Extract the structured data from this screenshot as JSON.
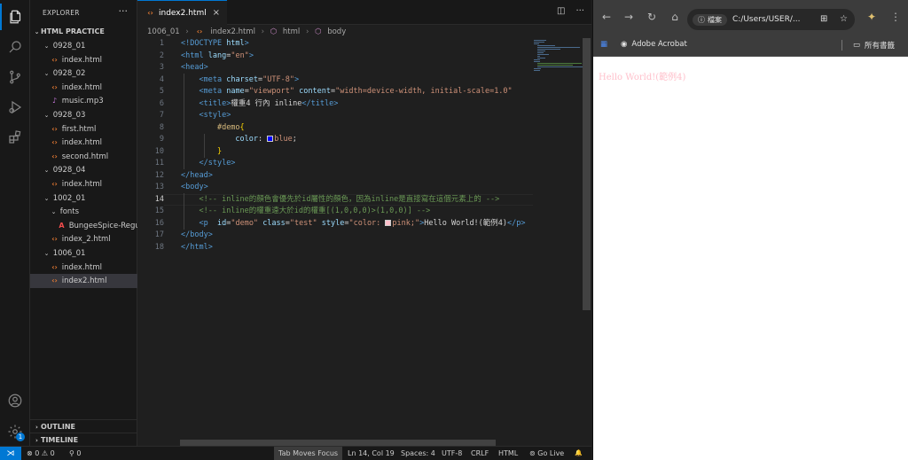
{
  "explorer": {
    "title": "EXPLORER",
    "more": "···",
    "root": "HTML PRACTICE",
    "items": [
      {
        "label": "0928_01",
        "type": "folder"
      },
      {
        "label": "index.html",
        "type": "html"
      },
      {
        "label": "0928_02",
        "type": "folder"
      },
      {
        "label": "index.html",
        "type": "html"
      },
      {
        "label": "music.mp3",
        "type": "music"
      },
      {
        "label": "0928_03",
        "type": "folder"
      },
      {
        "label": "first.html",
        "type": "html"
      },
      {
        "label": "index.html",
        "type": "html"
      },
      {
        "label": "second.html",
        "type": "html"
      },
      {
        "label": "0928_04",
        "type": "folder"
      },
      {
        "label": "index.html",
        "type": "html"
      },
      {
        "label": "1002_01",
        "type": "folder"
      },
      {
        "label": "fonts",
        "type": "folder"
      },
      {
        "label": "BungeeSpice-Regu...",
        "type": "font"
      },
      {
        "label": "index_2.html",
        "type": "html"
      },
      {
        "label": "1006_01",
        "type": "folder"
      },
      {
        "label": "index.html",
        "type": "html"
      },
      {
        "label": "index2.html",
        "type": "html",
        "selected": true
      }
    ],
    "outline": "OUTLINE",
    "timeline": "TIMELINE"
  },
  "tab": {
    "label": "index2.html",
    "close": "×"
  },
  "breadcrumb": {
    "folder": "1006_01",
    "file": "index2.html",
    "html": "html",
    "body": "body"
  },
  "code": {
    "line_numbers": [
      "1",
      "2",
      "3",
      "4",
      "5",
      "6",
      "7",
      "8",
      "9",
      "10",
      "11",
      "12",
      "13",
      "14",
      "15",
      "16",
      "17",
      "18"
    ],
    "current_line": "14",
    "color_swatches": {
      "blue": "#0000ff",
      "pink": "#ffc0cb"
    },
    "lines": [
      [
        {
          "c": "t-tag",
          "t": "<!DOCTYPE "
        },
        {
          "c": "t-attr",
          "t": "html"
        },
        {
          "c": "t-tag",
          "t": ">"
        }
      ],
      [
        {
          "c": "t-tag",
          "t": "<html "
        },
        {
          "c": "t-attr",
          "t": "lang"
        },
        {
          "c": "t-txt",
          "t": "="
        },
        {
          "c": "t-str",
          "t": "\"en\""
        },
        {
          "c": "t-tag",
          "t": ">"
        }
      ],
      [
        {
          "c": "t-tag",
          "t": "<head>"
        }
      ],
      [
        {
          "c": "t-txt",
          "t": "    "
        },
        {
          "c": "t-tag",
          "t": "<meta "
        },
        {
          "c": "t-attr",
          "t": "charset"
        },
        {
          "c": "t-txt",
          "t": "="
        },
        {
          "c": "t-str",
          "t": "\"UTF-8\""
        },
        {
          "c": "t-tag",
          "t": ">"
        }
      ],
      [
        {
          "c": "t-txt",
          "t": "    "
        },
        {
          "c": "t-tag",
          "t": "<meta "
        },
        {
          "c": "t-attr",
          "t": "name"
        },
        {
          "c": "t-txt",
          "t": "="
        },
        {
          "c": "t-str",
          "t": "\"viewport\""
        },
        {
          "c": "t-txt",
          "t": " "
        },
        {
          "c": "t-attr",
          "t": "content"
        },
        {
          "c": "t-txt",
          "t": "="
        },
        {
          "c": "t-str",
          "t": "\"width=device-width, initial-scale=1.0\""
        }
      ],
      [
        {
          "c": "t-txt",
          "t": "    "
        },
        {
          "c": "t-tag",
          "t": "<title>"
        },
        {
          "c": "t-txt",
          "t": "權重4 行內 inline"
        },
        {
          "c": "t-tag",
          "t": "</title>"
        }
      ],
      [
        {
          "c": "t-txt",
          "t": "    "
        },
        {
          "c": "t-tag",
          "t": "<style>"
        }
      ],
      [
        {
          "c": "t-txt",
          "t": "        "
        },
        {
          "c": "t-sel",
          "t": "#demo"
        },
        {
          "c": "t-brk",
          "t": "{"
        }
      ],
      [
        {
          "c": "t-txt",
          "t": "            "
        },
        {
          "c": "t-prop",
          "t": "color"
        },
        {
          "c": "t-txt",
          "t": ": "
        },
        {
          "c": "sw",
          "t": "blue"
        },
        {
          "c": "t-val",
          "t": "blue"
        },
        {
          "c": "t-txt",
          "t": ";"
        }
      ],
      [
        {
          "c": "t-txt",
          "t": "        "
        },
        {
          "c": "t-brk",
          "t": "}"
        }
      ],
      [
        {
          "c": "t-txt",
          "t": "    "
        },
        {
          "c": "t-tag",
          "t": "</style>"
        }
      ],
      [
        {
          "c": "t-tag",
          "t": "</head>"
        }
      ],
      [
        {
          "c": "t-tag",
          "t": "<body>"
        }
      ],
      [
        {
          "c": "t-txt",
          "t": "    "
        },
        {
          "c": "t-cmt",
          "t": "<!-- inline的顏色會優先於id屬性的顏色，因為inline是直接寫在這個元素上的 -->"
        }
      ],
      [
        {
          "c": "t-txt",
          "t": "    "
        },
        {
          "c": "t-cmt",
          "t": "<!-- inline的權重遠大於id的權重[(1,0,0,0)>(1,0,0)] -->"
        }
      ],
      [
        {
          "c": "t-txt",
          "t": "    "
        },
        {
          "c": "t-tag",
          "t": "<p  "
        },
        {
          "c": "t-attr",
          "t": "id"
        },
        {
          "c": "t-txt",
          "t": "="
        },
        {
          "c": "t-str",
          "t": "\"demo\""
        },
        {
          "c": "t-txt",
          "t": " "
        },
        {
          "c": "t-attr",
          "t": "class"
        },
        {
          "c": "t-txt",
          "t": "="
        },
        {
          "c": "t-str",
          "t": "\"test\""
        },
        {
          "c": "t-txt",
          "t": " "
        },
        {
          "c": "t-attr",
          "t": "style"
        },
        {
          "c": "t-txt",
          "t": "="
        },
        {
          "c": "t-str",
          "t": "\"color: "
        },
        {
          "c": "sw",
          "t": "pink"
        },
        {
          "c": "t-str",
          "t": "pink;\""
        },
        {
          "c": "t-tag",
          "t": ">"
        },
        {
          "c": "t-txt",
          "t": "Hello World!(範例4)"
        },
        {
          "c": "t-tag",
          "t": "</p>"
        }
      ],
      [
        {
          "c": "t-tag",
          "t": "</body>"
        }
      ],
      [
        {
          "c": "t-tag",
          "t": "</html>"
        }
      ]
    ]
  },
  "status": {
    "remote": "⋊",
    "problems": "⊗ 0 ⚠ 0",
    "ports": "⚲ 0",
    "tab_focus": "Tab Moves Focus",
    "position": "Ln 14, Col 19",
    "spaces": "Spaces: 4",
    "encoding": "UTF-8",
    "eol": "CRLF",
    "language": "HTML",
    "golive": "Go Live",
    "bell": "🔔"
  },
  "browser": {
    "info_chip": "檔案",
    "url": "C:/Users/USER/...",
    "bookmark_acrobat": "Adobe Acrobat",
    "bookmark_all": "所有書籤",
    "page_text": "Hello World!(範例4)",
    "page_text_color": "#ffc0cb"
  },
  "accent": "#0078d4"
}
